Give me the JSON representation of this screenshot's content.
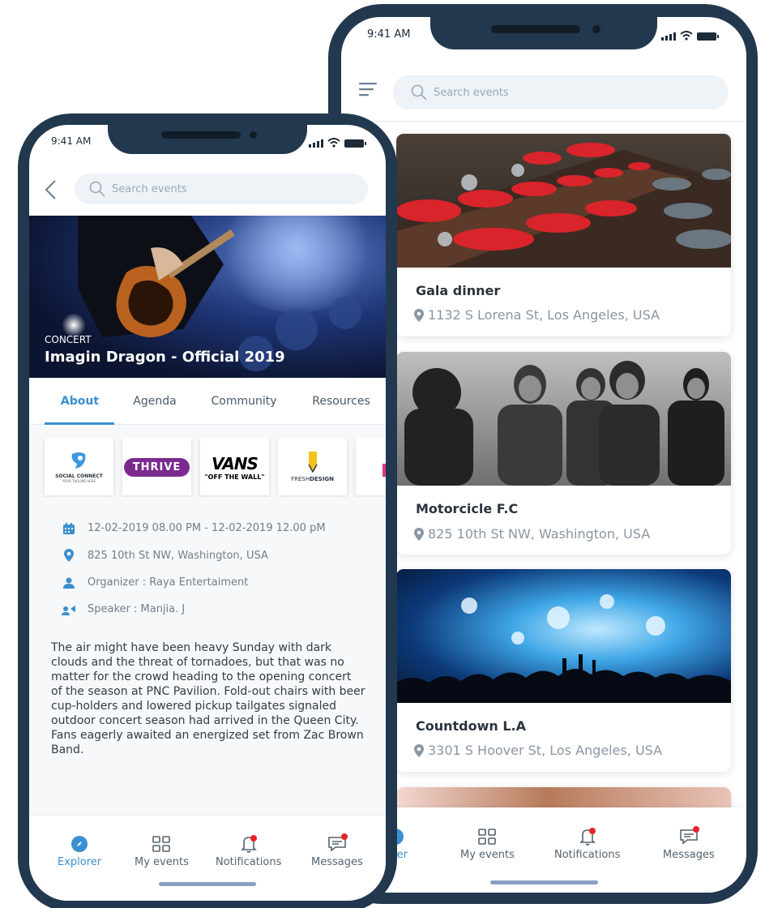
{
  "status": {
    "time": "9:41 AM"
  },
  "search": {
    "placeholder": "Search events"
  },
  "event": {
    "category": "CONCERT",
    "title": "Imagin Dragon - Official 2019",
    "tabs": [
      "About",
      "Agenda",
      "Community",
      "Resources"
    ],
    "sponsors": {
      "social_connect": {
        "line1": "SOCIAL CONNECT",
        "line2": "YOUR TAGLINE HERE"
      },
      "thrive": "THRIVE",
      "vans": {
        "line1": "VANS",
        "line2": "\"OFF THE WALL\""
      },
      "fresh_design": {
        "line1": "FRESH",
        "line2": "DESIGN"
      }
    },
    "date": "12-02-2019  08.00 PM  -  12-02-2019  12.00 pM",
    "location": "825 10th St NW, Washington,  USA",
    "organizer": "Organizer : Raya Entertaiment",
    "speaker": "Speaker : Manjia. J",
    "description": "The air might have been heavy Sunday with dark clouds and the threat of tornadoes, but that was no matter for the crowd heading to the opening concert of the season at PNC Pavilion. Fold-out chairs with beer cup-holders and lowered pickup tailgates signaled outdoor concert season had arrived in the Queen City. Fans eagerly awaited an energized set from Zac Brown Band."
  },
  "list": {
    "events": [
      {
        "title": "Gala dinner",
        "address": "1132 S Lorena St, Los Angeles, USA"
      },
      {
        "title": "Motorcicle F.C",
        "address": "825 10th St NW, Washington,  USA"
      },
      {
        "title": "Countdown L.A",
        "address": "3301 S Hoover St, Los Angeles, USA"
      }
    ]
  },
  "nav": {
    "explorer": "Explorer",
    "explorer_partial": "lorer",
    "my_events": "My events",
    "notifications": "Notifications",
    "messages": "Messages"
  },
  "colors": {
    "accent": "#3a8fd0",
    "phone_frame": "#22384e",
    "badge": "#e8222a"
  }
}
